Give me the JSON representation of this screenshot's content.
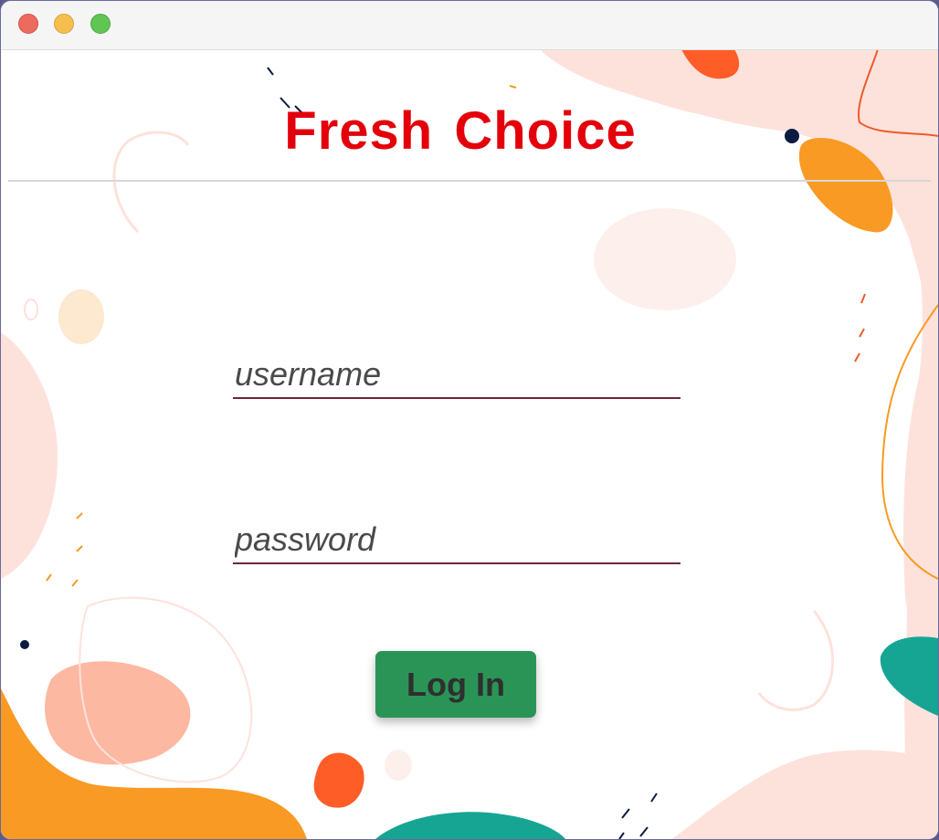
{
  "window": {
    "controls": {
      "close": "close-icon",
      "minimize": "minimize-icon",
      "maximize": "maximize-icon"
    }
  },
  "app": {
    "title": "Fresh Choice"
  },
  "form": {
    "username_placeholder": "username",
    "password_placeholder": "password",
    "login_label": "Log In"
  },
  "colors": {
    "title": "#e3000b",
    "button": "#2a9457",
    "field_underline": "#6b2737",
    "teal": "#17a593",
    "orange": "#f89a24",
    "salmon": "#fdb8a2",
    "blush": "#fde2dc"
  }
}
